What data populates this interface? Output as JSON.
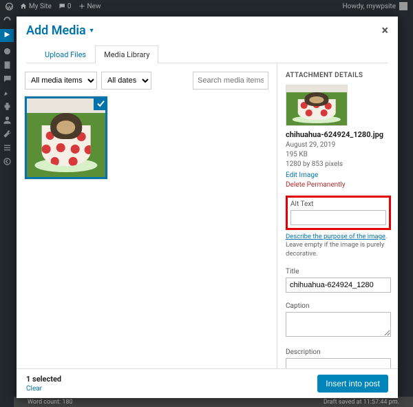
{
  "adminbar": {
    "site": "My Site",
    "comments": "0",
    "new": "New",
    "howdy": "Howdy, mywpsite"
  },
  "editor_strip": {
    "wordcount": "Word count: 180",
    "draft": "Draft saved at 11:57:44 pm."
  },
  "modal": {
    "title": "Add Media",
    "tabs": {
      "upload": "Upload Files",
      "library": "Media Library"
    },
    "filters": {
      "type": "All media items",
      "date": "All dates",
      "search_placeholder": "Search media items"
    },
    "details": {
      "heading": "ATTACHMENT DETAILS",
      "filename": "chihuahua-624924_1280.jpg",
      "date": "August 29, 2019",
      "size": "195 KB",
      "dimensions": "1280 by 853 pixels",
      "edit": "Edit Image",
      "delete": "Delete Permanently",
      "alt_label": "Alt Text",
      "alt_value": "",
      "hint_link": "Describe the purpose of the image",
      "hint_rest": ". Leave empty if the image is purely decorative.",
      "title_label": "Title",
      "title_value": "chihuahua-624924_1280",
      "caption_label": "Caption",
      "caption_value": "",
      "desc_label": "Description",
      "desc_value": ""
    },
    "footer": {
      "selected": "1 selected",
      "clear": "Clear",
      "insert": "Insert into post"
    }
  }
}
